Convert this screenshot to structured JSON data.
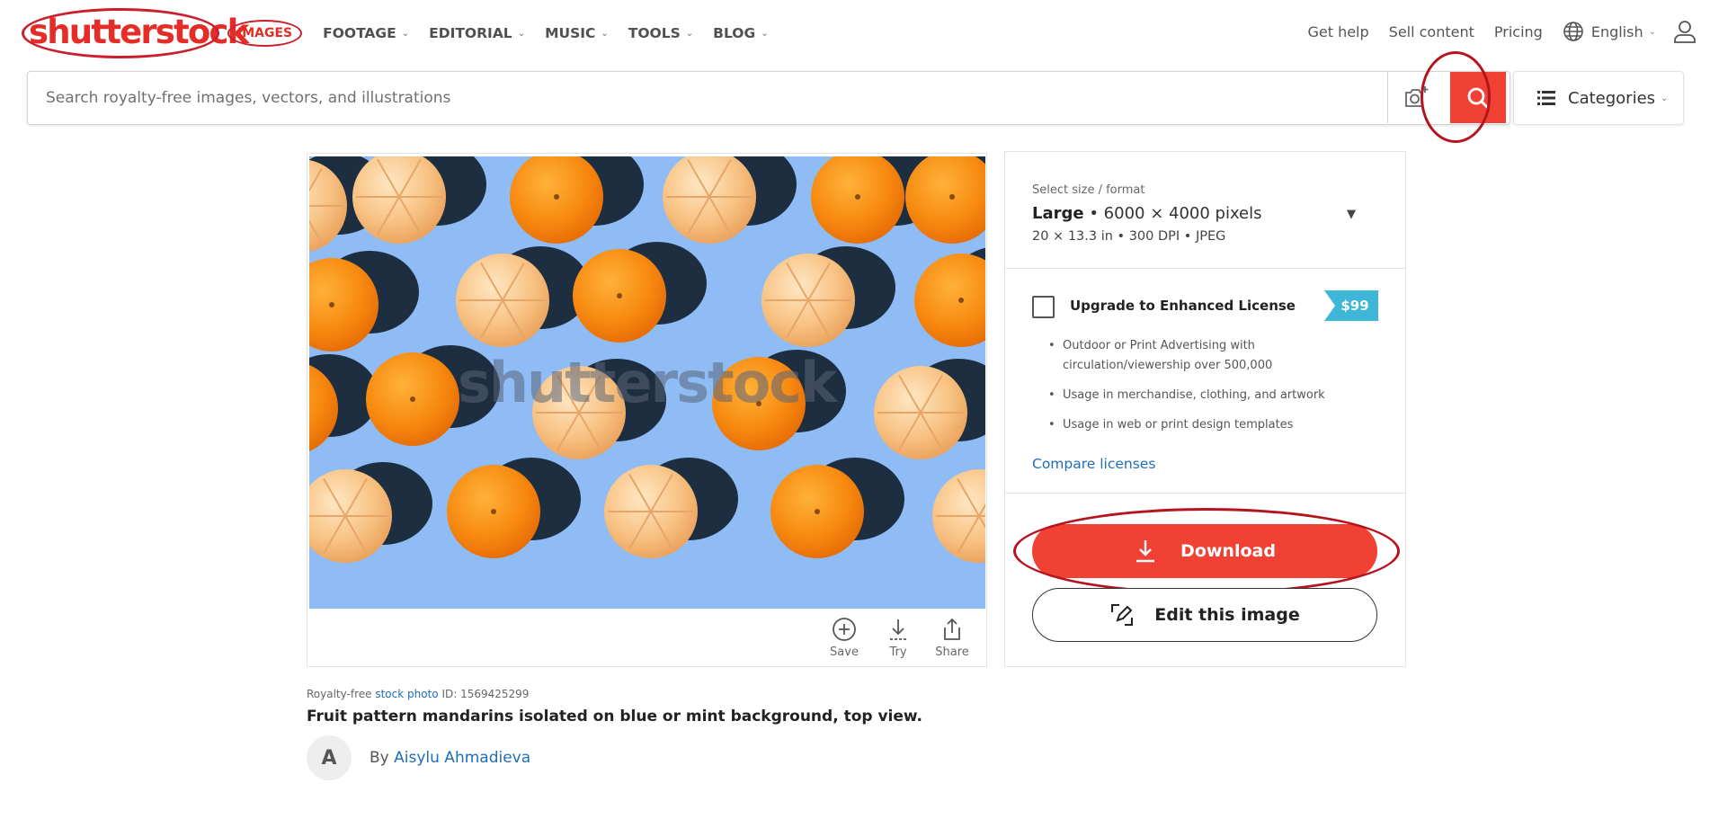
{
  "header": {
    "logo_text": "shutterstock",
    "nav": [
      {
        "label": "IMAGES",
        "active": true
      },
      {
        "label": "FOOTAGE"
      },
      {
        "label": "EDITORIAL"
      },
      {
        "label": "MUSIC"
      },
      {
        "label": "TOOLS"
      },
      {
        "label": "BLOG"
      }
    ],
    "links": {
      "help": "Get help",
      "sell": "Sell content",
      "pricing": "Pricing",
      "language": "English"
    },
    "icons": {
      "language": "globe-icon",
      "user": "user-icon",
      "chevron": "chevron-down-icon"
    }
  },
  "search": {
    "placeholder": "Search royalty-free images, vectors, and illustrations",
    "camera_icon": "camera-icon",
    "search_icon": "search-icon",
    "categories_label": "Categories"
  },
  "image": {
    "watermark": "shutterstock",
    "actions": [
      {
        "label": "Save",
        "icon": "plus-circle-icon"
      },
      {
        "label": "Try",
        "icon": "download-icon"
      },
      {
        "label": "Share",
        "icon": "share-icon"
      }
    ],
    "meta": {
      "prefix": "Royalty-free",
      "type_link": "stock photo",
      "id_label": "ID: 1569425299"
    },
    "title": "Fruit pattern mandarins isolated on blue or mint background, top view.",
    "author": {
      "initial": "A",
      "by": "By",
      "name": "Aisylu Ahmadieva"
    }
  },
  "license": {
    "size_label": "Select size / format",
    "size_name": "Large",
    "size_dims": "• 6000 × 4000 pixels",
    "size_sub": "20 × 13.3 in • 300 DPI • JPEG",
    "upgrade_label": "Upgrade to Enhanced License",
    "upgrade_price": "$99",
    "bullets": [
      "Outdoor or Print Advertising with circulation/viewership over 500,000",
      "Usage in merchandise, clothing, and artwork",
      "Usage in web or print design templates"
    ],
    "compare": "Compare licenses",
    "download": "Download",
    "edit": "Edit this image"
  },
  "colors": {
    "brand": "#e52d27",
    "accent_button": "#f04134",
    "annotation_ring": "#b5141f",
    "photo_background": "#8fbcf5",
    "price_badge": "#3db6d8",
    "link": "#1f6db8"
  }
}
